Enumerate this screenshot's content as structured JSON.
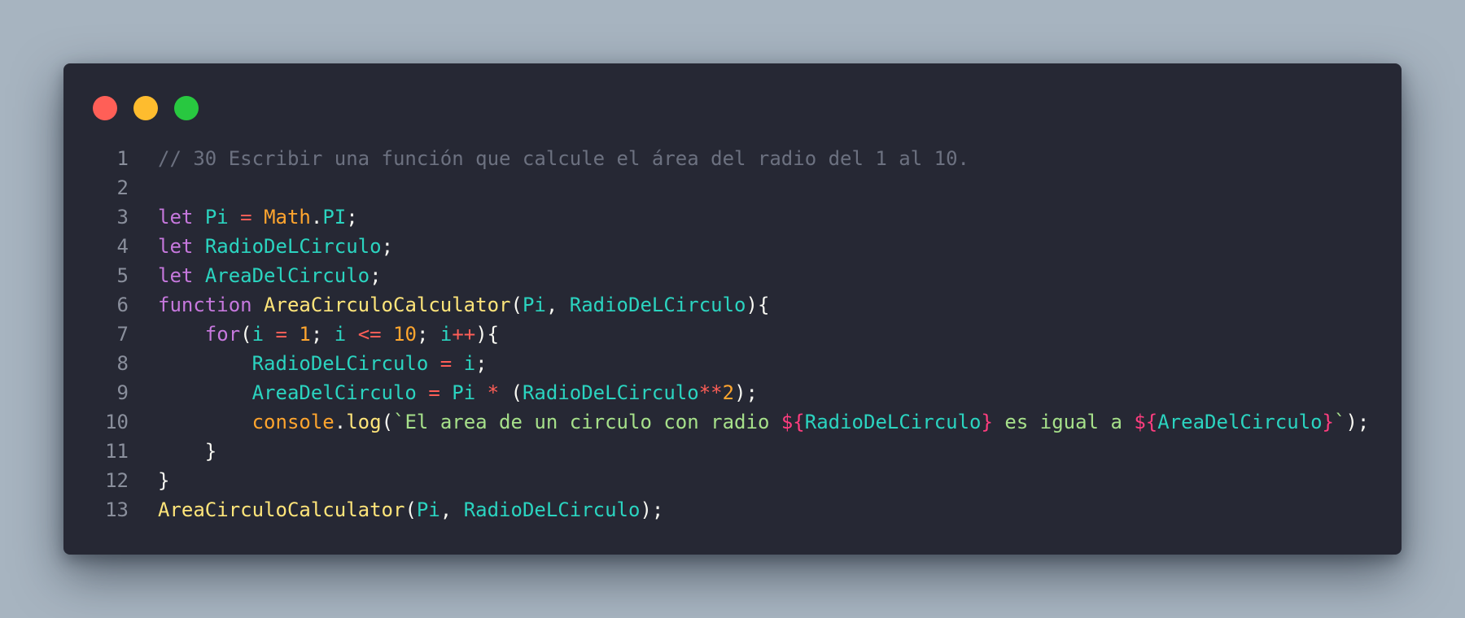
{
  "window": {
    "controls": [
      {
        "name": "close",
        "color": "#ff5f57"
      },
      {
        "name": "minimize",
        "color": "#febc2e"
      },
      {
        "name": "maximize",
        "color": "#28c840"
      }
    ]
  },
  "code": {
    "language": "javascript",
    "lines": [
      {
        "number": "1",
        "tokens": [
          {
            "t": "comment",
            "v": "// 30 Escribir una función que calcule el área del radio del 1 al 10."
          }
        ]
      },
      {
        "number": "2",
        "tokens": []
      },
      {
        "number": "3",
        "tokens": [
          {
            "t": "keyword",
            "v": "let"
          },
          {
            "t": "punct",
            "v": " "
          },
          {
            "t": "variable",
            "v": "Pi"
          },
          {
            "t": "punct",
            "v": " "
          },
          {
            "t": "operator",
            "v": "="
          },
          {
            "t": "punct",
            "v": " "
          },
          {
            "t": "class",
            "v": "Math"
          },
          {
            "t": "punct",
            "v": "."
          },
          {
            "t": "variable",
            "v": "PI"
          },
          {
            "t": "punct",
            "v": ";"
          }
        ]
      },
      {
        "number": "4",
        "tokens": [
          {
            "t": "keyword",
            "v": "let"
          },
          {
            "t": "punct",
            "v": " "
          },
          {
            "t": "variable",
            "v": "RadioDeLCirculo"
          },
          {
            "t": "punct",
            "v": ";"
          }
        ]
      },
      {
        "number": "5",
        "tokens": [
          {
            "t": "keyword",
            "v": "let"
          },
          {
            "t": "punct",
            "v": " "
          },
          {
            "t": "variable",
            "v": "AreaDelCirculo"
          },
          {
            "t": "punct",
            "v": ";"
          }
        ]
      },
      {
        "number": "6",
        "tokens": [
          {
            "t": "keyword",
            "v": "function"
          },
          {
            "t": "punct",
            "v": " "
          },
          {
            "t": "function",
            "v": "AreaCirculoCalculator"
          },
          {
            "t": "punct",
            "v": "("
          },
          {
            "t": "variable",
            "v": "Pi"
          },
          {
            "t": "punct",
            "v": ", "
          },
          {
            "t": "variable",
            "v": "RadioDeLCirculo"
          },
          {
            "t": "punct",
            "v": "){"
          }
        ]
      },
      {
        "number": "7",
        "tokens": [
          {
            "t": "punct",
            "v": "    "
          },
          {
            "t": "keyword",
            "v": "for"
          },
          {
            "t": "punct",
            "v": "("
          },
          {
            "t": "variable",
            "v": "i"
          },
          {
            "t": "punct",
            "v": " "
          },
          {
            "t": "operator",
            "v": "="
          },
          {
            "t": "punct",
            "v": " "
          },
          {
            "t": "number",
            "v": "1"
          },
          {
            "t": "punct",
            "v": "; "
          },
          {
            "t": "variable",
            "v": "i"
          },
          {
            "t": "punct",
            "v": " "
          },
          {
            "t": "operator",
            "v": "<="
          },
          {
            "t": "punct",
            "v": " "
          },
          {
            "t": "number",
            "v": "10"
          },
          {
            "t": "punct",
            "v": "; "
          },
          {
            "t": "variable",
            "v": "i"
          },
          {
            "t": "operator",
            "v": "++"
          },
          {
            "t": "punct",
            "v": "){"
          }
        ]
      },
      {
        "number": "8",
        "tokens": [
          {
            "t": "punct",
            "v": "        "
          },
          {
            "t": "variable",
            "v": "RadioDeLCirculo"
          },
          {
            "t": "punct",
            "v": " "
          },
          {
            "t": "operator",
            "v": "="
          },
          {
            "t": "punct",
            "v": " "
          },
          {
            "t": "variable",
            "v": "i"
          },
          {
            "t": "punct",
            "v": ";"
          }
        ]
      },
      {
        "number": "9",
        "tokens": [
          {
            "t": "punct",
            "v": "        "
          },
          {
            "t": "variable",
            "v": "AreaDelCirculo"
          },
          {
            "t": "punct",
            "v": " "
          },
          {
            "t": "operator",
            "v": "="
          },
          {
            "t": "punct",
            "v": " "
          },
          {
            "t": "variable",
            "v": "Pi"
          },
          {
            "t": "punct",
            "v": " "
          },
          {
            "t": "operator",
            "v": "*"
          },
          {
            "t": "punct",
            "v": " ("
          },
          {
            "t": "variable",
            "v": "RadioDeLCirculo"
          },
          {
            "t": "operator",
            "v": "**"
          },
          {
            "t": "number",
            "v": "2"
          },
          {
            "t": "punct",
            "v": ");"
          }
        ]
      },
      {
        "number": "10",
        "tokens": [
          {
            "t": "punct",
            "v": "        "
          },
          {
            "t": "builtin",
            "v": "console"
          },
          {
            "t": "punct",
            "v": "."
          },
          {
            "t": "function",
            "v": "log"
          },
          {
            "t": "punct",
            "v": "("
          },
          {
            "t": "string",
            "v": "`El area de un circulo con radio "
          },
          {
            "t": "interp",
            "v": "${"
          },
          {
            "t": "variable",
            "v": "RadioDeLCirculo"
          },
          {
            "t": "interp",
            "v": "}"
          },
          {
            "t": "string",
            "v": " es igual a "
          },
          {
            "t": "interp",
            "v": "${"
          },
          {
            "t": "variable",
            "v": "AreaDelCirculo"
          },
          {
            "t": "interp",
            "v": "}"
          },
          {
            "t": "string",
            "v": "`"
          },
          {
            "t": "punct",
            "v": ");"
          }
        ]
      },
      {
        "number": "11",
        "tokens": [
          {
            "t": "punct",
            "v": "    }"
          }
        ]
      },
      {
        "number": "12",
        "tokens": [
          {
            "t": "punct",
            "v": "}"
          }
        ]
      },
      {
        "number": "13",
        "tokens": [
          {
            "t": "function",
            "v": "AreaCirculoCalculator"
          },
          {
            "t": "punct",
            "v": "("
          },
          {
            "t": "variable",
            "v": "Pi"
          },
          {
            "t": "punct",
            "v": ", "
          },
          {
            "t": "variable",
            "v": "RadioDeLCirculo"
          },
          {
            "t": "punct",
            "v": ");"
          }
        ]
      }
    ]
  }
}
